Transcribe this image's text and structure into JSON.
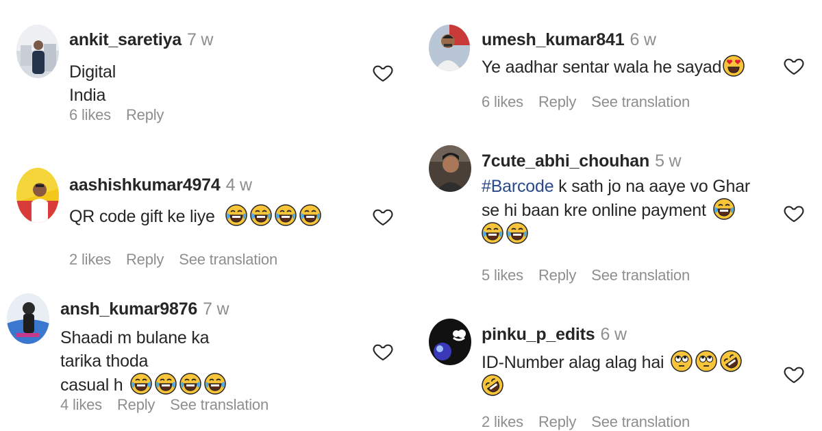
{
  "left_column": [
    {
      "username": "ankit_saretiya",
      "age": "7 w",
      "text": "Digital India",
      "likes": "6 likes",
      "reply": "Reply",
      "translate": ""
    },
    {
      "username": "aashishkumar4974",
      "age": "4 w",
      "text": "QR code gift ke liye",
      "likes": "2 likes",
      "reply": "Reply",
      "translate": "See translation"
    },
    {
      "username": "ansh_kumar9876",
      "age": "7 w",
      "text_line1": "Shaadi m bulane ka tarika thoda",
      "text_line2": "casual h",
      "likes": "4 likes",
      "reply": "Reply",
      "translate": "See translation"
    }
  ],
  "right_column": [
    {
      "username": "umesh_kumar841",
      "age": "6 w",
      "text": "Ye aadhar sentar wala he sayad",
      "likes": "6 likes",
      "reply": "Reply",
      "translate": "See translation"
    },
    {
      "username": "7cute_abhi_chouhan",
      "age": "5 w",
      "hashtag": "#Barcode",
      "text_line1": " k sath jo na aaye vo Ghar",
      "text_line2": "se hi baan kre online payment",
      "likes": "5 likes",
      "reply": "Reply",
      "translate": "See translation"
    },
    {
      "username": "pinku_p_edits",
      "age": "6 w",
      "text": "ID-Number alag alag hai",
      "likes": "2 likes",
      "reply": "Reply",
      "translate": "See translation"
    }
  ],
  "icons": {
    "like": "heart-outline-icon",
    "laugh": "face-with-tears-of-joy-emoji",
    "heart_eyes": "heart-eyes-emoji",
    "rolling_eyes": "face-with-rolling-eyes-emoji",
    "rofl": "rolling-on-floor-laughing-emoji"
  },
  "colors": {
    "text": "#262626",
    "muted": "#8e8e8e",
    "hashtag": "#2a4a8a",
    "emoji_yellow": "#f7c43a"
  }
}
